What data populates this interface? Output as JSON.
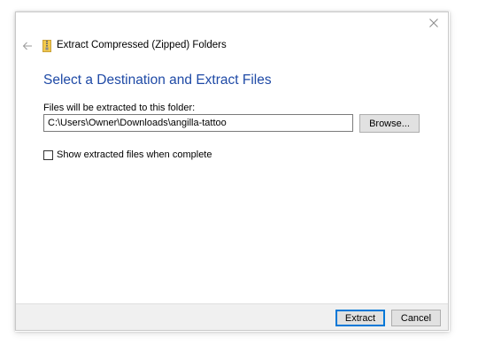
{
  "dialog": {
    "title": "Extract Compressed (Zipped) Folders",
    "heading": "Select a Destination and Extract Files",
    "destination_label": "Files will be extracted to this folder:",
    "destination_value": "C:\\Users\\Owner\\Downloads\\angilla-tattoo",
    "browse_label": "Browse...",
    "show_files_label": "Show extracted files when complete",
    "show_files_checked": false,
    "extract_label": "Extract",
    "cancel_label": "Cancel"
  },
  "icons": {
    "close": "close-icon",
    "back": "back-arrow-icon",
    "zip_folder": "zip-folder-icon"
  },
  "colors": {
    "heading": "#1f4aa6",
    "primary_button_border": "#0078d7",
    "footer_background": "#f0f0f0",
    "zip_folder": "#f2c94c"
  }
}
